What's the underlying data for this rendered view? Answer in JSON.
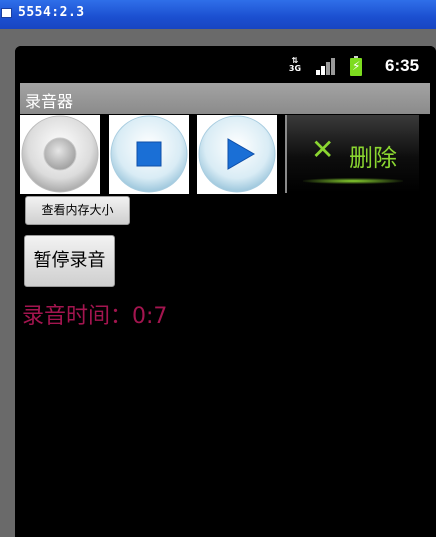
{
  "window": {
    "title": "5554:2.3"
  },
  "status_bar": {
    "network_type": "3G",
    "time": "6:35"
  },
  "app": {
    "title": "录音器"
  },
  "buttons": {
    "record_icon": "record-icon",
    "stop_icon": "stop-icon",
    "play_icon": "play-icon",
    "delete_label": "删除",
    "delete_icon": "x-icon",
    "memory_label": "查看内存大小",
    "pause_label": "暂停录音"
  },
  "recording": {
    "time_text": "录音时间：0:7"
  },
  "colors": {
    "accent_green": "#8bd631",
    "time_text": "#a3154f",
    "stop_play_blue": "#1a6fd6"
  }
}
